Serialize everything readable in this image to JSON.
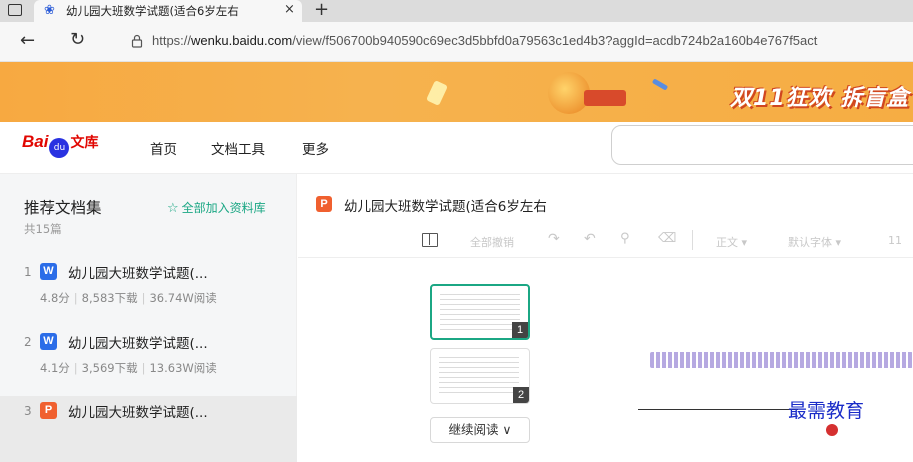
{
  "browser": {
    "tab": {
      "favicon": "baidu-paw-icon",
      "title": "幼儿园大班数学试题(适合6岁左右",
      "close": "×"
    },
    "newtab": "+",
    "url": {
      "prefix": "https://",
      "host": "wenku.baidu.com",
      "path": "/view/f506700b940590c69ec3d5bbfd0a79563c1ed4b3?aggId=acdb724b2a160b4e767f5act"
    }
  },
  "banner": {
    "text": "双11狂欢 拆盲盒"
  },
  "header": {
    "logo": {
      "bai": "Bai",
      "paw": "du",
      "wenku": "文库"
    },
    "nav": [
      "首页",
      "文档工具",
      "更多"
    ]
  },
  "sidebar": {
    "title": "推荐文档集",
    "count": "共15篇",
    "add_all": "全部加入资料库",
    "items": [
      {
        "index": "1",
        "type": "W",
        "title": "幼儿园大班数学试题(...",
        "score": "4.8分",
        "downloads": "8,583下载",
        "reads": "36.74W阅读"
      },
      {
        "index": "2",
        "type": "W",
        "title": "幼儿园大班数学试题(...",
        "score": "4.1分",
        "downloads": "3,569下载",
        "reads": "13.63W阅读"
      },
      {
        "index": "3",
        "type": "P",
        "title": "幼儿园大班数学试题(..."
      }
    ]
  },
  "document": {
    "type": "P",
    "title": "幼儿园大班数学试题(适合6岁左右",
    "toolbar": {
      "undo_all": "全部撤销",
      "body_style": "正文 ▾",
      "font": "默认字体 ▾",
      "font_size": "11"
    },
    "thumbnails": [
      "1",
      "2"
    ],
    "continue": "继续阅读 ∨",
    "watermark": "最需教育"
  },
  "colors": {
    "accent": "#1ba784",
    "brand_red": "#e10601",
    "banner": "#f6ad43"
  }
}
